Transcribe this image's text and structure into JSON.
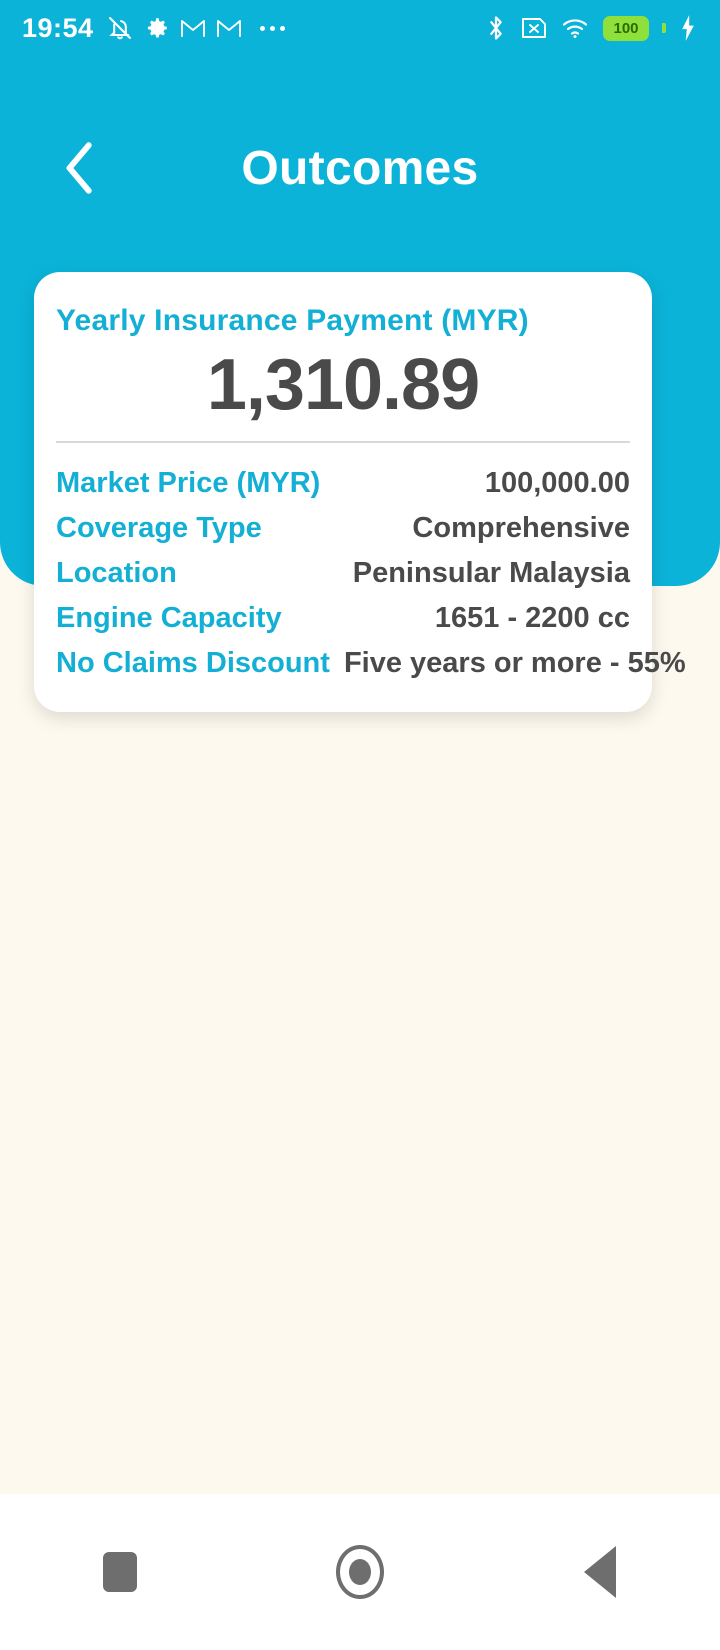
{
  "status_bar": {
    "time": "19:54",
    "left_icons": [
      "bell-muted-icon",
      "gear-icon",
      "gmail-icon",
      "gmail-icon",
      "overflow-dots-icon"
    ],
    "right_icons": [
      "bluetooth-icon",
      "no-sim-icon",
      "wifi-icon",
      "battery-icon",
      "charging-bolt-icon"
    ],
    "battery_level": "100"
  },
  "app_bar": {
    "title": "Outcomes",
    "back_icon": "chevron-left-icon"
  },
  "card": {
    "title": "Yearly Insurance Payment (MYR)",
    "amount": "1,310.89",
    "rows": [
      {
        "label": "Market Price (MYR)",
        "value": "100,000.00"
      },
      {
        "label": "Coverage Type",
        "value": "Comprehensive"
      },
      {
        "label": "Location",
        "value": "Peninsular Malaysia"
      },
      {
        "label": "Engine Capacity",
        "value": "1651 - 2200 cc"
      },
      {
        "label": "No Claims Discount",
        "value": "Five years or more - 55%"
      }
    ]
  },
  "nav_bar": {
    "recents_label": "recents-button",
    "home_label": "home-button",
    "back_label": "back-button"
  },
  "colors": {
    "accent": "#0BB3D9",
    "label": "#13AFD4",
    "value": "#4A4A4A",
    "page_background": "#FDF9EE",
    "card_background": "#FFFFFF",
    "battery_green": "#8FE03A"
  }
}
